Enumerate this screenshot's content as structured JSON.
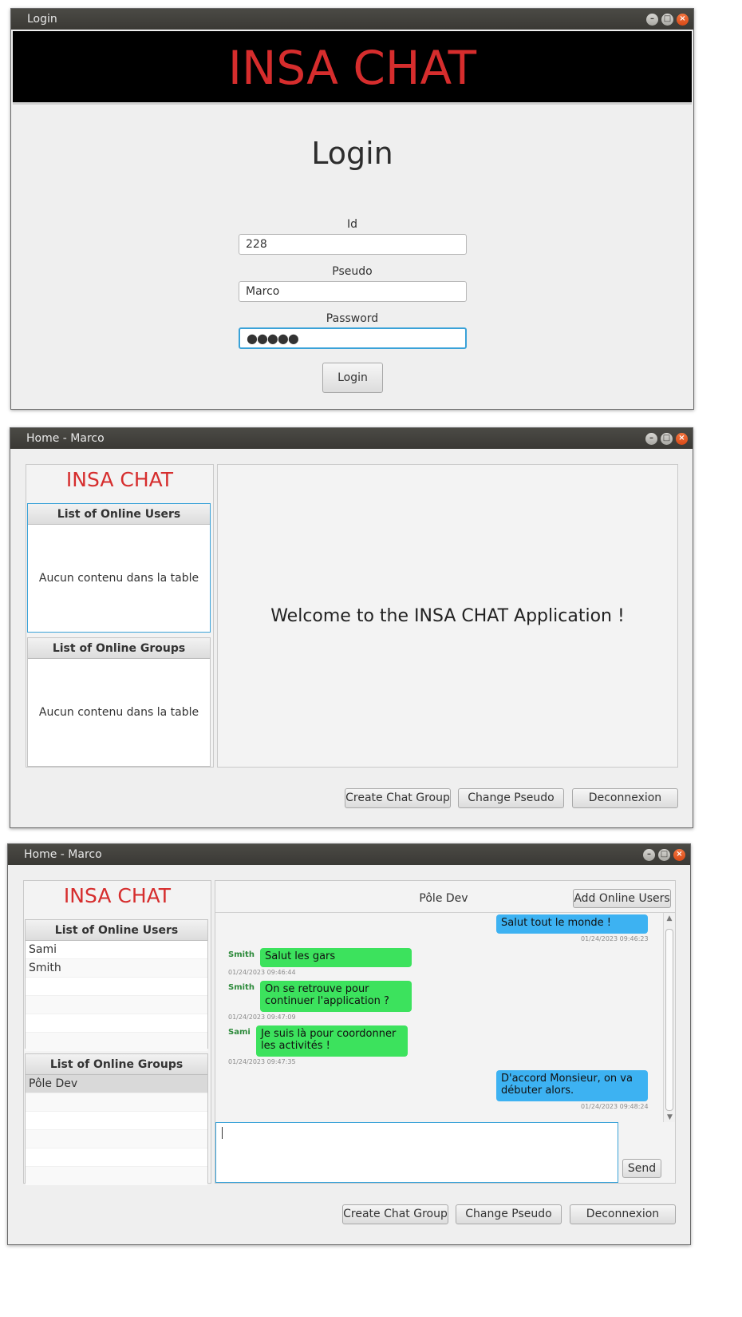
{
  "login_window": {
    "title": "Login",
    "banner": "INSA CHAT",
    "heading": "Login",
    "id_label": "Id",
    "id_value": "228",
    "pseudo_label": "Pseudo",
    "pseudo_value": "Marco",
    "password_label": "Password",
    "password_value": "●●●●●",
    "login_button": "Login"
  },
  "home_window": {
    "title": "Home - Marco",
    "brand": "INSA CHAT",
    "users_header": "List of Online Users",
    "users_empty": "Aucun contenu dans la table",
    "groups_header": "List of Online Groups",
    "groups_empty": "Aucun contenu dans la table",
    "welcome": "Welcome to the INSA CHAT Application !",
    "buttons": {
      "create": "Create Chat Group",
      "change": "Change Pseudo",
      "logout": "Deconnexion"
    }
  },
  "chat_window": {
    "title": "Home - Marco",
    "brand": "INSA CHAT",
    "users_header": "List of Online Users",
    "users": [
      "Sami",
      "Smith"
    ],
    "groups_header": "List of Online Groups",
    "groups": [
      "Pôle Dev"
    ],
    "group_name": "Pôle Dev",
    "add_users_button": "Add Online Users",
    "messages": [
      {
        "sender": "",
        "text": "Salut tout le monde !",
        "time": "01/24/2023 09:46:23"
      },
      {
        "sender": "Smith",
        "text": "Salut les gars",
        "time": "01/24/2023 09:46:44"
      },
      {
        "sender": "Smith",
        "text": "On se retrouve pour continuer l'application ?",
        "time": "01/24/2023 09:47:09"
      },
      {
        "sender": "Sami",
        "text": "Je suis là pour coordonner les activités !",
        "time": "01/24/2023 09:47:35"
      },
      {
        "sender": "",
        "text": "D'accord Monsieur, on va débuter alors.",
        "time": "01/24/2023 09:48:24"
      }
    ],
    "send_button": "Send",
    "buttons": {
      "create": "Create Chat Group",
      "change": "Change Pseudo",
      "logout": "Deconnexion"
    }
  },
  "colors": {
    "brand_red": "#d62d2d",
    "focus_blue": "#3aa2d8",
    "outgoing_bubble": "#3db2f2",
    "incoming_bubble": "#3ce25d"
  }
}
